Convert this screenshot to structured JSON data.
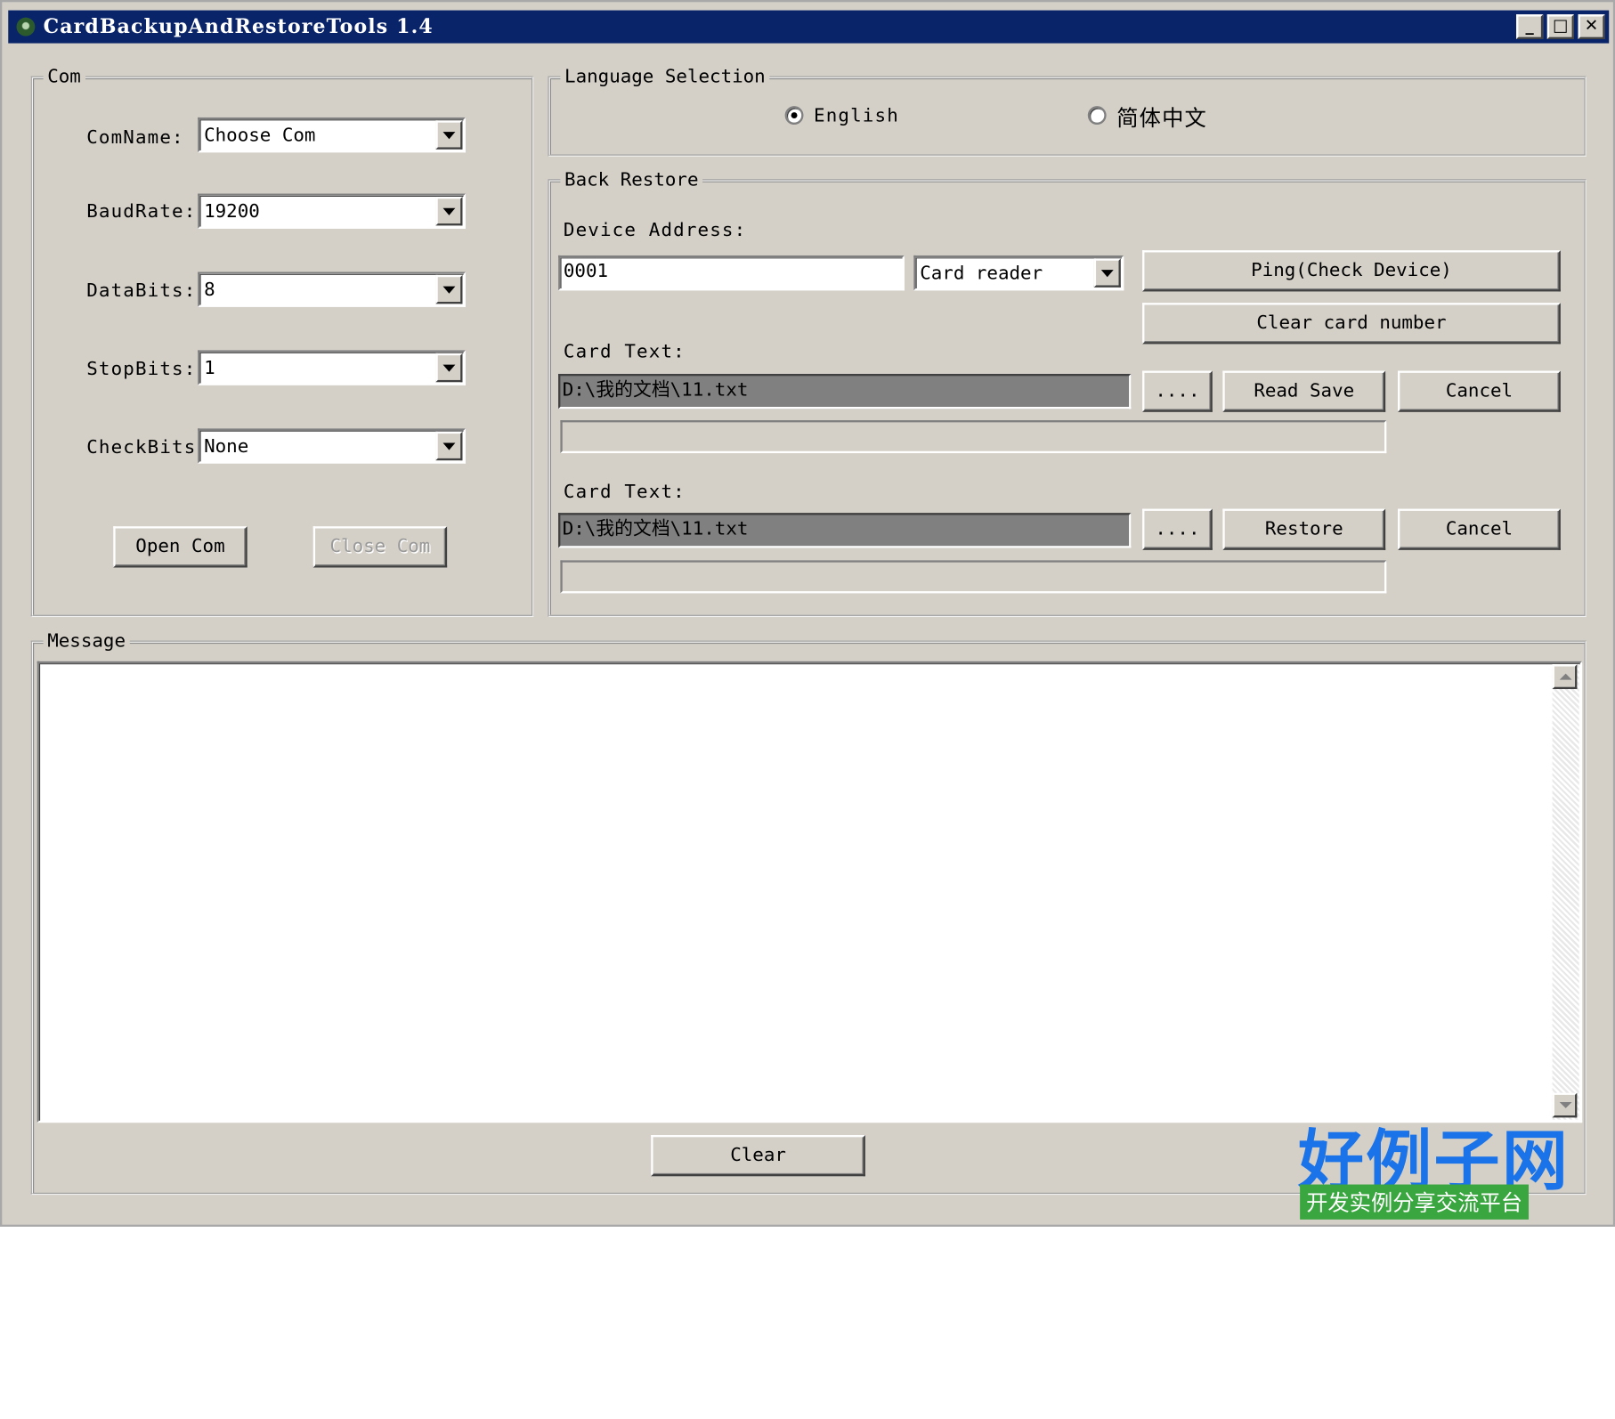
{
  "window": {
    "title": "CardBackupAndRestoreTools 1.4",
    "minimize_glyph": "_",
    "maximize_glyph": "□",
    "close_glyph": "✕"
  },
  "com_group": {
    "legend": "Com",
    "fields": [
      {
        "label": "ComName:",
        "value": "Choose Com"
      },
      {
        "label": "BaudRate:",
        "value": "19200"
      },
      {
        "label": "DataBits:",
        "value": "8"
      },
      {
        "label": "StopBits:",
        "value": "1"
      },
      {
        "label": "CheckBits:",
        "value": "None"
      }
    ],
    "open_label": "Open Com",
    "close_label": "Close Com"
  },
  "language_group": {
    "legend": "Language Selection",
    "options": [
      {
        "label": "English",
        "checked": true
      },
      {
        "label": "简体中文",
        "checked": false
      }
    ]
  },
  "back_restore": {
    "legend": "Back Restore",
    "device_address_label": "Device Address:",
    "device_address_value": "0001",
    "device_type_value": "Card reader",
    "ping_label": "Ping(Check Device)",
    "clear_card_label": "Clear card number",
    "backup": {
      "label": "Card Text:",
      "path": "D:\\我的文档\\11.txt",
      "browse_label": "....",
      "action_label": "Read Save",
      "cancel_label": "Cancel"
    },
    "restore": {
      "label": "Card Text:",
      "path": "D:\\我的文档\\11.txt",
      "browse_label": "....",
      "action_label": "Restore",
      "cancel_label": "Cancel"
    }
  },
  "message_group": {
    "legend": "Message",
    "content": "",
    "clear_label": "Clear"
  },
  "watermark": {
    "logo_text": "好例子网",
    "tagline": "开发实例分享交流平台"
  },
  "colors": {
    "titlebar": "#0a246a",
    "face": "#d4d0c8",
    "path_field": "#808080",
    "logo_blue": "#1a73e8",
    "logo_green": "#3aa63f"
  }
}
